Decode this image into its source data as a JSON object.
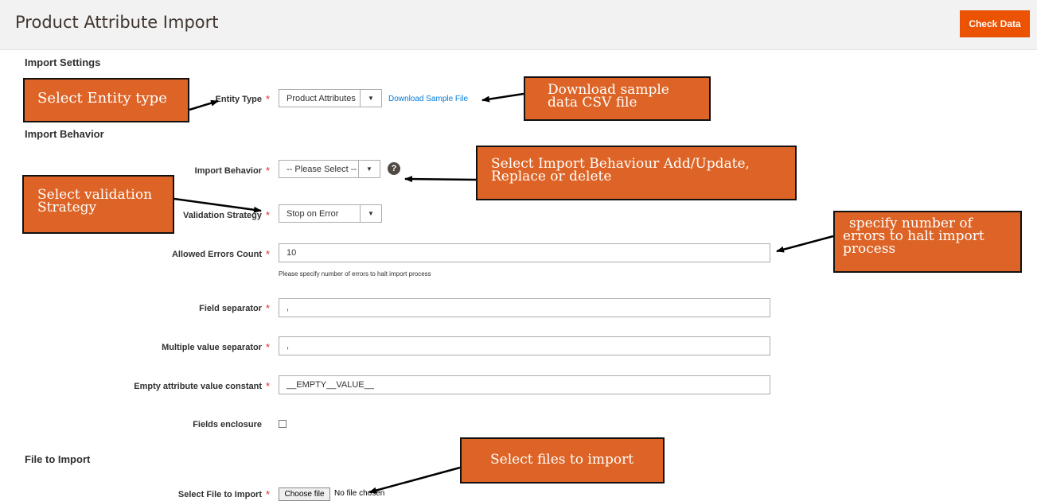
{
  "header": {
    "title": "Product Attribute Import",
    "check_button": "Check Data"
  },
  "sections": {
    "import_settings": "Import Settings",
    "import_behavior": "Import Behavior",
    "file_to_import": "File to Import"
  },
  "fields": {
    "entity_type": {
      "label": "Entity Type",
      "value": "Product Attributes",
      "link": "Download Sample File"
    },
    "import_behavior": {
      "label": "Import Behavior",
      "value": "-- Please Select --"
    },
    "validation_strategy": {
      "label": "Validation Strategy",
      "value": "Stop on Error"
    },
    "allowed_errors": {
      "label": "Allowed Errors Count",
      "value": "10",
      "note": "Please specify number of errors to halt import process"
    },
    "field_separator": {
      "label": "Field separator",
      "value": ","
    },
    "multiple_value_separator": {
      "label": "Multiple value separator",
      "value": ","
    },
    "empty_attribute": {
      "label": "Empty attribute value constant",
      "value": "__EMPTY__VALUE__"
    },
    "fields_enclosure": {
      "label": "Fields enclosure",
      "checked": false
    },
    "select_file": {
      "label": "Select File to Import",
      "button": "Choose file",
      "status": "No file chosen"
    }
  },
  "required_mark": "*",
  "help_icon": "question-icon",
  "callouts": {
    "entity": "Select Entity type",
    "download": [
      "Download sample",
      "data CSV file"
    ],
    "behavior": [
      "Select Import Behaviour Add/Update,",
      "Replace or delete"
    ],
    "validation": [
      "Select validation",
      "Strategy"
    ],
    "errors": [
      "specify number of",
      "errors to halt import",
      "process"
    ],
    "files": "Select files to import"
  },
  "colors": {
    "accent": "#eb5202",
    "callout": "#dd6426",
    "link": "#007bdb",
    "required": "#e22626"
  }
}
